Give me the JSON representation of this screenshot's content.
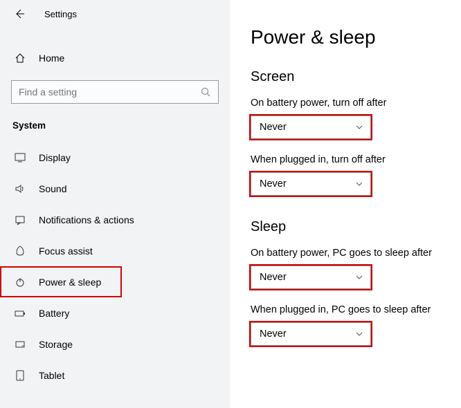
{
  "titlebar": {
    "title": "Settings"
  },
  "home": {
    "label": "Home"
  },
  "search": {
    "placeholder": "Find a setting"
  },
  "section_label": "System",
  "nav": [
    {
      "label": "Display",
      "icon": "display-icon"
    },
    {
      "label": "Sound",
      "icon": "sound-icon"
    },
    {
      "label": "Notifications & actions",
      "icon": "notifications-icon"
    },
    {
      "label": "Focus assist",
      "icon": "focus-icon"
    },
    {
      "label": "Power & sleep",
      "icon": "power-icon",
      "selected": true,
      "highlighted": true
    },
    {
      "label": "Battery",
      "icon": "battery-icon"
    },
    {
      "label": "Storage",
      "icon": "storage-icon"
    },
    {
      "label": "Tablet",
      "icon": "tablet-icon"
    }
  ],
  "page": {
    "title": "Power & sleep",
    "groups": [
      {
        "heading": "Screen",
        "fields": [
          {
            "label": "On battery power, turn off after",
            "value": "Never",
            "highlighted": true
          },
          {
            "label": "When plugged in, turn off after",
            "value": "Never",
            "highlighted": true
          }
        ]
      },
      {
        "heading": "Sleep",
        "fields": [
          {
            "label": "On battery power, PC goes to sleep after",
            "value": "Never",
            "highlighted": true
          },
          {
            "label": "When plugged in, PC goes to sleep after",
            "value": "Never",
            "highlighted": true
          }
        ]
      }
    ]
  },
  "colors": {
    "highlight": "#d40000",
    "sidebar_bg": "#f1f3f5"
  }
}
